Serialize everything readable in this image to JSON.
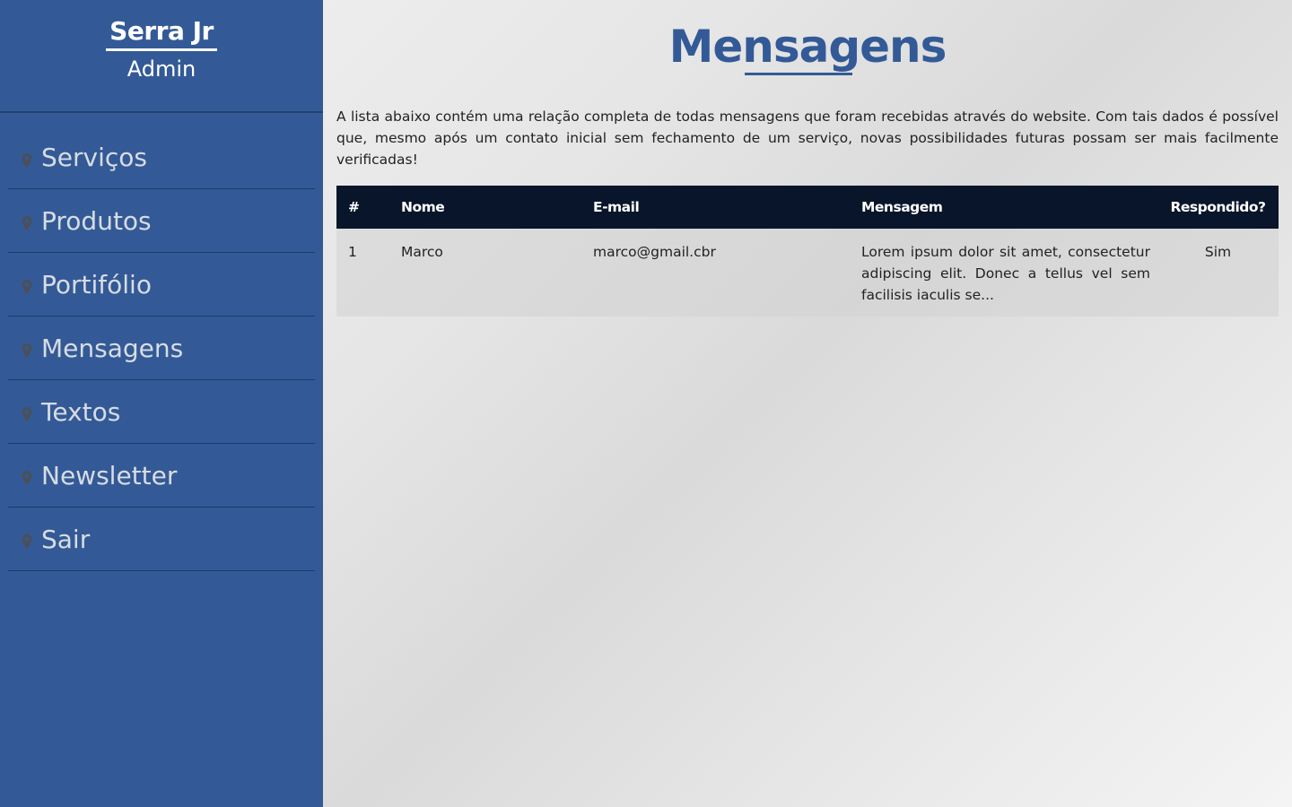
{
  "sidebar": {
    "brand_title": "Serra Jr",
    "brand_subtitle": "Admin",
    "items": [
      {
        "label": "Serviços",
        "icon": "map-pin-icon"
      },
      {
        "label": "Produtos",
        "icon": "map-pin-icon"
      },
      {
        "label": "Portifólio",
        "icon": "map-pin-icon"
      },
      {
        "label": "Mensagens",
        "icon": "map-pin-icon"
      },
      {
        "label": "Textos",
        "icon": "map-pin-icon"
      },
      {
        "label": "Newsletter",
        "icon": "map-pin-icon"
      },
      {
        "label": "Sair",
        "icon": "map-pin-icon"
      }
    ]
  },
  "main": {
    "title": "Mensagens",
    "intro": "A lista abaixo contém uma relação completa de todas mensagens que foram recebidas através do website. Com tais dados é possível que, mesmo após um contato inicial sem fechamento de um serviço, novas possibilidades futuras possam ser mais facilmente verificadas!",
    "table": {
      "headers": [
        "#",
        "Nome",
        "E-mail",
        "Mensagem",
        "Respondido?"
      ],
      "rows": [
        [
          "1",
          "Marco",
          "marco@gmail.cbr",
          "Lorem ipsum dolor sit amet, consectetur adipiscing elit. Donec a tellus vel sem facilisis iaculis se...",
          "Sim"
        ]
      ]
    }
  },
  "colors": {
    "sidebar_bg": "#335a97",
    "title": "#335a97",
    "table_header_bg": "#08152a",
    "nav_text": "#d8dce3"
  }
}
